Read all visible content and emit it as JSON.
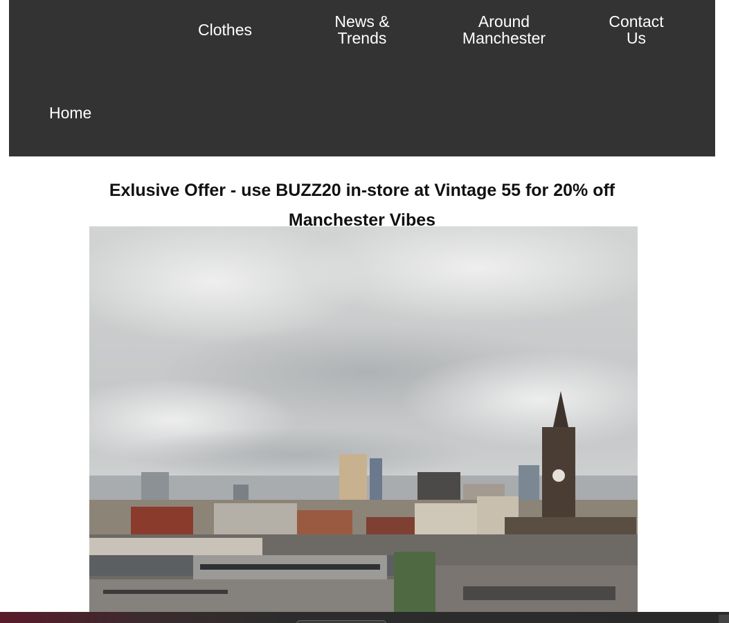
{
  "nav": {
    "items": [
      {
        "label": "Clothes"
      },
      {
        "label": "News &\nTrends"
      },
      {
        "label": "Around\nManchester"
      },
      {
        "label": "Contact\nUs"
      },
      {
        "label": "Home"
      }
    ]
  },
  "main": {
    "offer_heading": "Exlusive Offer - use BUZZ20 in-store at Vintage 55 for 20% off",
    "section_heading": "Manchester Vibes"
  },
  "colors": {
    "nav_background": "#333333",
    "nav_text": "#ffffff",
    "heading_text": "#111111"
  }
}
